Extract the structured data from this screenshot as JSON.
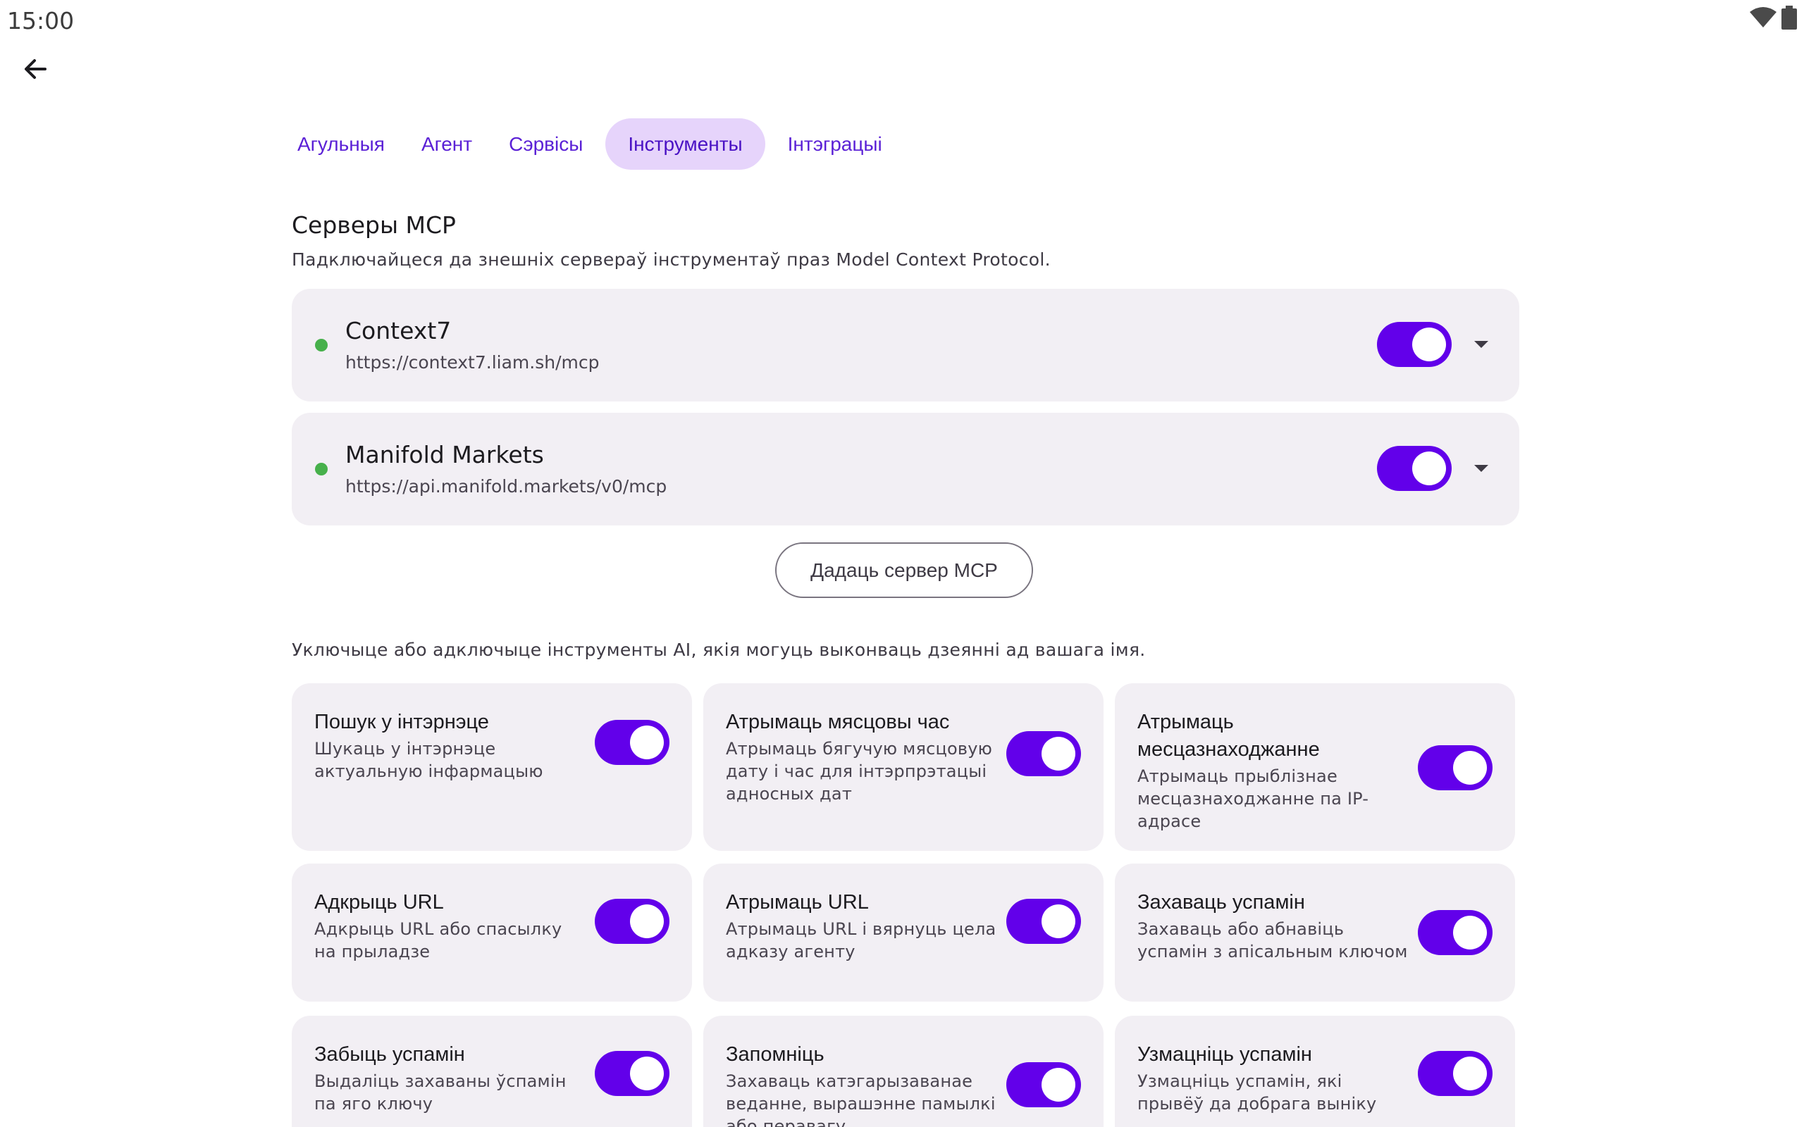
{
  "status": {
    "time": "15:00",
    "wifi_icon": "wifi-icon",
    "battery_icon": "battery-icon"
  },
  "nav": {
    "back_icon": "arrow-left-icon"
  },
  "tabs": [
    {
      "label": "Агульныя",
      "active": false
    },
    {
      "label": "Агент",
      "active": false
    },
    {
      "label": "Сэрвісы",
      "active": false
    },
    {
      "label": "Інструменты",
      "active": true
    },
    {
      "label": "Інтэграцыі",
      "active": false
    }
  ],
  "mcp": {
    "title": "Серверы MCP",
    "description": "Падключайцеся да знешніх сервераў інструментаў праз Model Context Protocol.",
    "servers": [
      {
        "name": "Context7",
        "url": "https://context7.liam.sh/mcp",
        "status_color": "#47b04b",
        "enabled": true
      },
      {
        "name": "Manifold Markets",
        "url": "https://api.manifold.markets/v0/mcp",
        "status_color": "#47b04b",
        "enabled": true
      }
    ],
    "add_button": "Дадаць сервер MCP"
  },
  "tools": {
    "description": "Уключыце або адключыце інструменты AI, якія могуць выконваць дзеянні ад вашага імя.",
    "items": [
      {
        "title": "Пошук у інтэрнэце",
        "desc": "Шукаць у інтэрнэце актуальную інфармацыю",
        "enabled": true
      },
      {
        "title": "Атрымаць мясцовы час",
        "desc": "Атрымаць бягучую мясцовую дату і час для інтэрпрэтацыі адносных дат",
        "enabled": true
      },
      {
        "title": "Атрымаць месцазнаходжанне",
        "desc": "Атрымаць прыблізнае месцазнаходжанне па IP-адрасе",
        "enabled": true
      },
      {
        "title": "Адкрыць URL",
        "desc": "Адкрыць URL або спасылку на прыладзе",
        "enabled": true
      },
      {
        "title": "Атрымаць URL",
        "desc": "Атрымаць URL і вярнуць цела адказу агенту",
        "enabled": true
      },
      {
        "title": "Захаваць успамін",
        "desc": "Захаваць або абнавіць успамін з апісальным ключом",
        "enabled": true
      },
      {
        "title": "Забыць успамін",
        "desc": "Выдаліць захаваны ўспамін па яго ключу",
        "enabled": true
      },
      {
        "title": "Запомніць",
        "desc": "Захаваць катэгарызаванае веданне, вырашэнне памылкі або перавагу",
        "enabled": true
      },
      {
        "title": "Узмацніць успамін",
        "desc": "Узмацніць успамін, які прывёў да добрага выніку",
        "enabled": true
      }
    ]
  },
  "colors": {
    "accent": "#6200ea",
    "tab_active_bg": "#e6d4fb",
    "card_bg": "#f2eff4",
    "status_ok": "#47b04b"
  }
}
